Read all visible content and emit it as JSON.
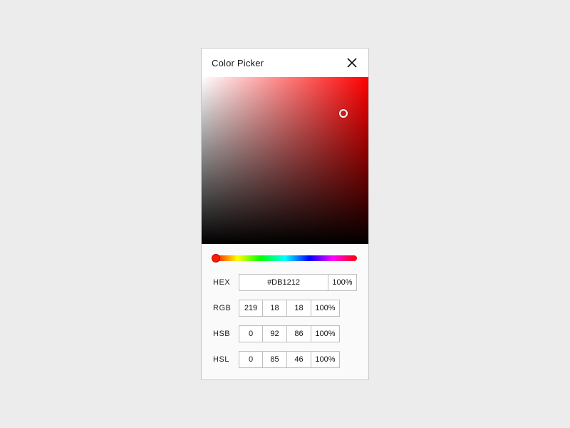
{
  "title": "Color Picker",
  "hex": {
    "label": "HEX",
    "value": "#DB1212",
    "alpha": "100%"
  },
  "rgb": {
    "label": "RGB",
    "r": "219",
    "g": "18",
    "b": "18",
    "alpha": "100%"
  },
  "hsb": {
    "label": "HSB",
    "h": "0",
    "s": "92",
    "b": "86",
    "alpha": "100%"
  },
  "hsl": {
    "label": "HSL",
    "h": "0",
    "s": "85",
    "l": "46",
    "alpha": "100%"
  }
}
